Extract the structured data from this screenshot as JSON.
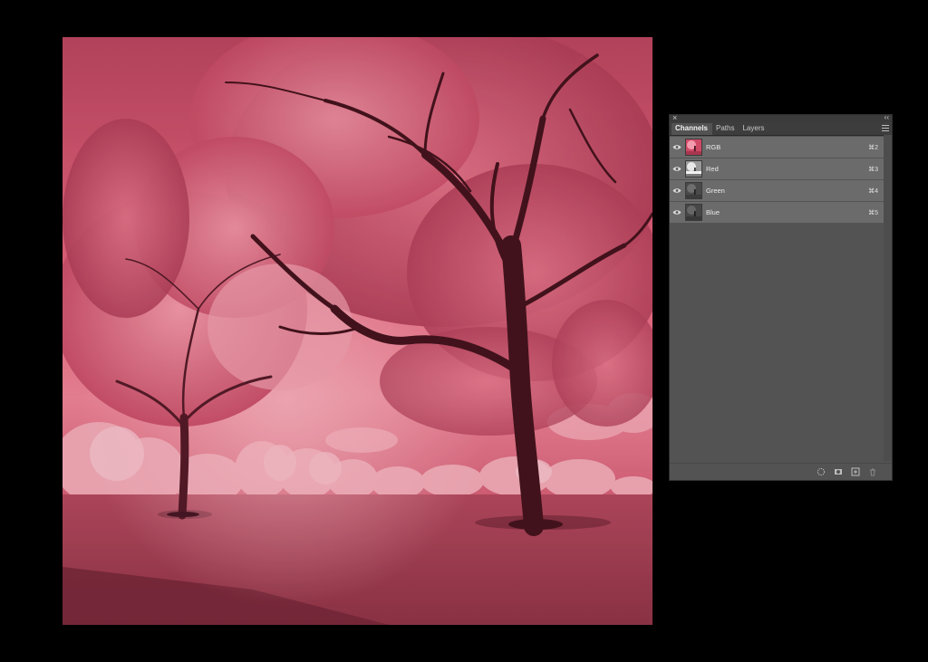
{
  "document": {
    "image_description_icon": "infrared-landscape-photo"
  },
  "panel": {
    "tabs": [
      {
        "label": "Channels",
        "active": true
      },
      {
        "label": "Paths",
        "active": false
      },
      {
        "label": "Layers",
        "active": false
      }
    ],
    "close_glyph": "×",
    "collapse_glyph": "‹‹",
    "channels": [
      {
        "name": "RGB",
        "shortcut": "⌘2",
        "visible": true,
        "thumb": "rgb-thumbnail"
      },
      {
        "name": "Red",
        "shortcut": "⌘3",
        "visible": true,
        "thumb": "red-thumbnail"
      },
      {
        "name": "Green",
        "shortcut": "⌘4",
        "visible": true,
        "thumb": "green-thumbnail"
      },
      {
        "name": "Blue",
        "shortcut": "⌘5",
        "visible": true,
        "thumb": "blue-thumbnail"
      }
    ],
    "footer_icons": [
      "load-selection-icon",
      "save-selection-icon",
      "new-channel-icon",
      "delete-channel-icon"
    ]
  },
  "colors": {
    "background": "#000000",
    "panel_bg": "#535353",
    "row_bg": "#6b6b6b",
    "photo_tint": "#e25a72"
  }
}
